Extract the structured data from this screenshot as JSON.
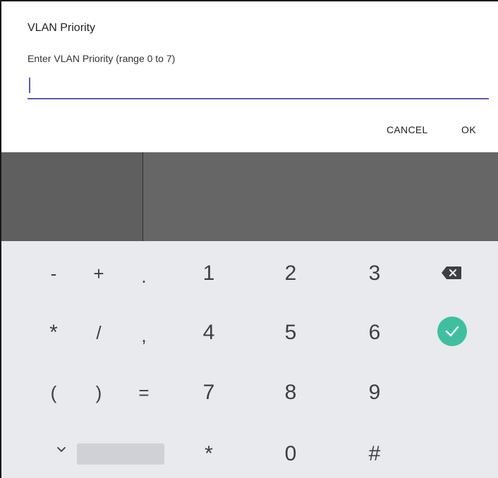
{
  "dialog": {
    "title": "VLAN Priority",
    "message": "Enter VLAN Priority (range 0 to 7)",
    "input_value": "",
    "cancel_label": "CANCEL",
    "ok_label": "OK"
  },
  "keyboard": {
    "keys": [
      "-",
      "+",
      ".",
      "1",
      "2",
      "3",
      "*",
      "/",
      ",",
      "4",
      "5",
      "6",
      "(",
      ")",
      "=",
      "7",
      "8",
      "9",
      "*",
      "0",
      "#"
    ],
    "icons": {
      "backspace": "backspace-icon",
      "done": "check-circle-icon",
      "hide": "chevron-down-icon"
    }
  },
  "colors": {
    "accent": "#5c5cb8",
    "done_button": "#3fbfa0",
    "keyboard_bg": "#e8eaed",
    "dim_overlay": "#666666"
  }
}
